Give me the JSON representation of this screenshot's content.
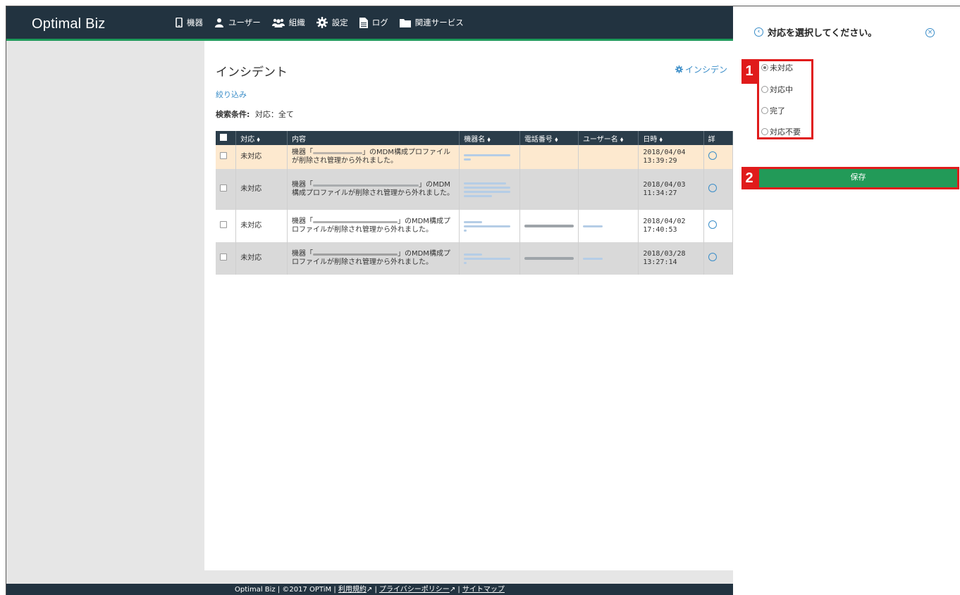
{
  "app": {
    "brand": "Optimal Biz"
  },
  "nav": [
    {
      "icon": "device-icon",
      "label": "機器"
    },
    {
      "icon": "user-icon",
      "label": "ユーザー"
    },
    {
      "icon": "group-icon",
      "label": "組織"
    },
    {
      "icon": "gear-icon",
      "label": "設定"
    },
    {
      "icon": "document-icon",
      "label": "ログ"
    },
    {
      "icon": "folder-icon",
      "label": "関連サービス"
    }
  ],
  "page": {
    "title": "インシデント",
    "settings_link": "インシデン",
    "filter_link": "絞り込み",
    "search_cond_label": "検索条件:",
    "search_cond_value": "対応：全て"
  },
  "table": {
    "headers": {
      "status": "対応 ⬧",
      "content": "内容",
      "device": "機器名 ⬧",
      "phone": "電話番号 ⬧",
      "user": "ユーザー名 ⬧",
      "date": "日時 ⬧",
      "detail": "詳"
    },
    "rows": [
      {
        "status": "未対応",
        "content_a": "機器「",
        "content_b": "」のMDM構成プロファイルが削除され管理から外れました。",
        "date": "2018/04/04",
        "time": "13:39:29"
      },
      {
        "status": "未対応",
        "content_a": "機器「",
        "content_b": "」のMDM構成プロファイルが削除され管理から外れました。",
        "date": "2018/04/03",
        "time": "11:34:27"
      },
      {
        "status": "未対応",
        "content_a": "機器「",
        "content_b": "」のMDM構成プロファイルが削除され管理から外れました。",
        "date": "2018/04/02",
        "time": "17:40:53"
      },
      {
        "status": "未対応",
        "content_a": "機器「",
        "content_b": "」のMDM構成プロファイルが削除され管理から外れました。",
        "date": "2018/03/28",
        "time": "13:27:14"
      }
    ]
  },
  "footer": {
    "prefix": "Optimal Biz | ©2017 OPTiM | ",
    "terms": "利用規約",
    "privacy": "プライバシーポリシー",
    "sitemap": "サイトマップ",
    "sep": " | "
  },
  "panel": {
    "title": "対応を選択してください。",
    "options": [
      "未対応",
      "対応中",
      "完了",
      "対応不要"
    ],
    "selected": "未対応",
    "save_label": "保存",
    "badge1": "1",
    "badge2": "2"
  },
  "colors": {
    "nav_bg": "#223340",
    "accent_green": "#229a58",
    "link_blue": "#3a8dc8",
    "alert_red": "#d32626",
    "highlight_red": "#e01b1b"
  }
}
